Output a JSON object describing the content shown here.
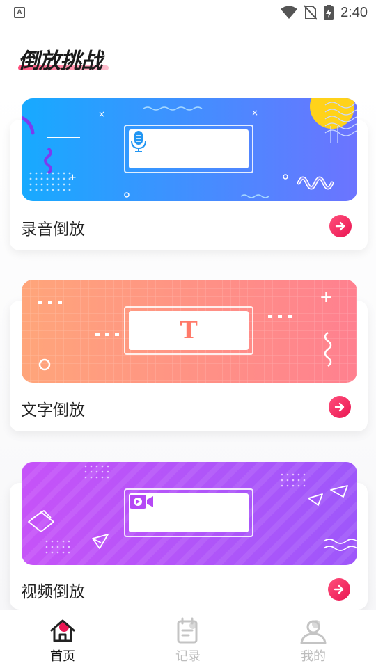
{
  "status_bar": {
    "time": "2:40",
    "notification_glyph": "A"
  },
  "header": {
    "title": "倒放挑战"
  },
  "cards": [
    {
      "label": "录音倒放",
      "icon": "microphone-icon",
      "theme": [
        "#22a6ff",
        "#6d75ff"
      ]
    },
    {
      "label": "文字倒放",
      "icon": "text-t-icon",
      "glyph": "T",
      "theme": [
        "#ffa77b",
        "#ff7f8f"
      ]
    },
    {
      "label": "视频倒放",
      "icon": "video-camera-icon",
      "theme": [
        "#c653f8",
        "#9e57fa"
      ]
    }
  ],
  "bottom_nav": [
    {
      "label": "首页",
      "icon": "home-icon",
      "active": true
    },
    {
      "label": "记录",
      "icon": "notebook-icon",
      "active": false
    },
    {
      "label": "我的",
      "icon": "user-icon",
      "active": false
    }
  ],
  "colors": {
    "accent": "#ea1653"
  }
}
